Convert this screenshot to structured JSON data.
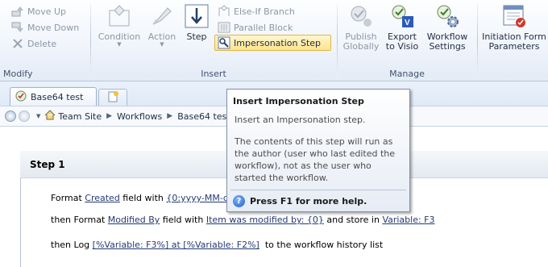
{
  "ribbon": {
    "modify": {
      "label": "Modify",
      "move_up": "Move Up",
      "move_down": "Move Down",
      "delete": "Delete"
    },
    "insert": {
      "label": "Insert",
      "condition": "Condition",
      "action": "Action",
      "step": "Step",
      "else_if_branch": "Else-If Branch",
      "parallel_block": "Parallel Block",
      "impersonation_step": "Impersonation Step"
    },
    "manage": {
      "label": "Manage",
      "publish_globally": [
        "Publish",
        "Globally"
      ],
      "export_to_visio": [
        "Export",
        "to Visio"
      ],
      "workflow_settings": [
        "Workflow",
        "Settings"
      ]
    },
    "initiation": {
      "label": [
        "Initiation Form",
        "Parameters"
      ]
    }
  },
  "tabs": {
    "active": "Base64 test"
  },
  "breadcrumb": [
    "Team Site",
    "Workflows",
    "Base64 test"
  ],
  "step": {
    "title": "Step 1",
    "line1": {
      "pre": "Format ",
      "field": "Created",
      "mid": " field with ",
      "format": "{0:yyyy-MM-dd}",
      "post": ""
    },
    "line2": {
      "pre": "then Format ",
      "field": "Modified By",
      "mid": " field with ",
      "format": "Item was modified by: {0}",
      "mid2": " and store in ",
      "var": "Variable: F3"
    },
    "line3": {
      "pre": "then Log ",
      "msg": "[%Variable: F3%] at [%Variable: F2%]",
      "post": "  to the workflow history list"
    }
  },
  "tooltip": {
    "title": "Insert Impersonation Step",
    "description": "Insert an Impersonation step.",
    "body": "The contents of this step will run as the author (user who last edited the workflow), not as the user who started the workflow.",
    "help": "Press F1 for more help."
  }
}
